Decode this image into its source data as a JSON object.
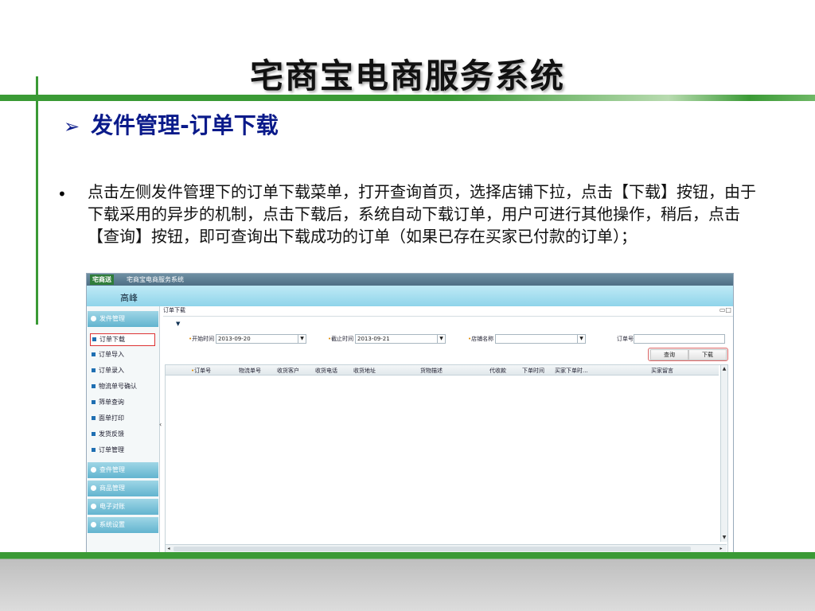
{
  "slide": {
    "title": "宅商宝电商服务系统",
    "heading_arrow": "➢",
    "heading": "发件管理-订单下载",
    "bullet": "•",
    "paragraph": "点击左侧发件管理下的订单下载菜单，打开查询首页，选择店铺下拉，点击【下载】按钮，由于下载采用的异步的机制，点击下载后，系统自动下载订单，用户可进行其他操作，稍后，点击【查询】按钮，即可查询出下载成功的订单（如果已存在买家已付款的订单）；"
  },
  "app": {
    "logo_text": "宅商送",
    "app_name": "宅商宝电商服务系统",
    "user_name": "高峰",
    "sidebar": {
      "sections": [
        {
          "label": "发件管理"
        },
        {
          "label": "查件管理"
        },
        {
          "label": "商品管理"
        },
        {
          "label": "电子对账"
        },
        {
          "label": "系统设置"
        }
      ],
      "items": [
        {
          "label": "订单下载"
        },
        {
          "label": "订单导入"
        },
        {
          "label": "订单录入"
        },
        {
          "label": "物流单号确认"
        },
        {
          "label": "筛单查询"
        },
        {
          "label": "面单打印"
        },
        {
          "label": "发货反馈"
        },
        {
          "label": "订单管理"
        }
      ],
      "collapse_handle": "‹"
    },
    "panel": {
      "title": "订单下载",
      "controls": "▭□",
      "filter_toggle": "▼",
      "filters": {
        "start_label": "开始时间",
        "start_value": "2013-09-20",
        "end_label": "截止时间",
        "end_value": "2013-09-21",
        "shop_label": "店铺名称",
        "shop_value": "",
        "order_label": "订单号",
        "order_value": "",
        "required_mark": "•",
        "dropdown_glyph": "▼"
      },
      "buttons": {
        "query": "查询",
        "download": "下载"
      },
      "columns": [
        "订单号",
        "物流单号",
        "收货客户",
        "收货电话",
        "收货地址",
        "货物描述",
        "代收款",
        "下单时间",
        "买家下单时...",
        "买家留言"
      ],
      "scroll": {
        "up": "▲",
        "down": "▼",
        "left": "◂",
        "right": "▸"
      }
    }
  }
}
